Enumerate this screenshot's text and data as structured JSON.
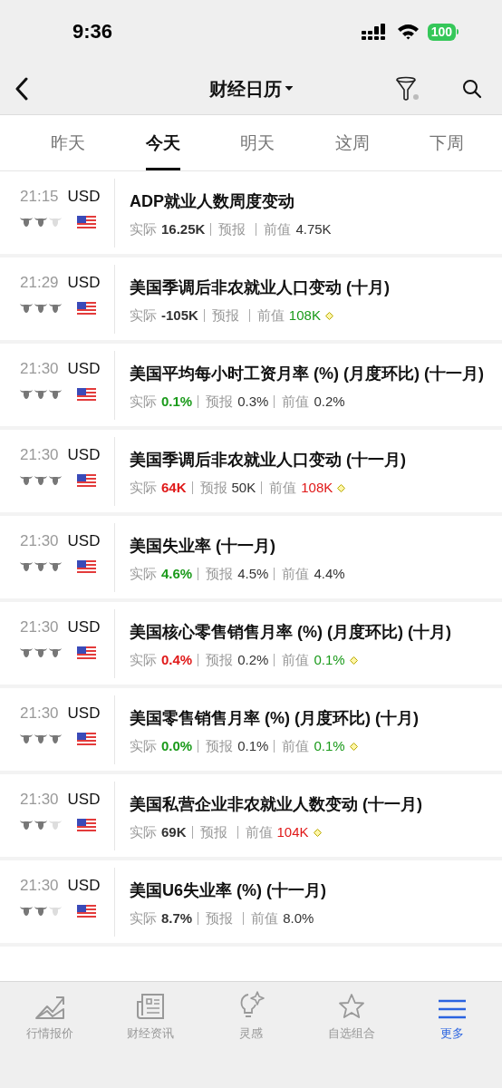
{
  "status_bar": {
    "time": "9:36",
    "battery": "100"
  },
  "nav": {
    "title": "财经日历",
    "filter_active": false
  },
  "tabs": [
    {
      "label": "昨天",
      "selected": false
    },
    {
      "label": "今天",
      "selected": true
    },
    {
      "label": "明天",
      "selected": false
    },
    {
      "label": "这周",
      "selected": false
    },
    {
      "label": "下周",
      "selected": false
    }
  ],
  "events": [
    {
      "time": "21:15",
      "currency": "USD",
      "stars": 2,
      "title": "ADP就业人数周度变动",
      "metrics": [
        {
          "label": "实际",
          "value": "16.25K",
          "color": "#333333"
        },
        {
          "label": "预报"
        },
        {
          "label": "前值",
          "value": "4.75K",
          "color": "#333333",
          "revised": false
        }
      ]
    },
    {
      "time": "21:29",
      "currency": "USD",
      "stars": 3,
      "title": "美国季调后非农就业人口变动 (十月)",
      "metrics": [
        {
          "label": "实际",
          "value": "-105K",
          "color": "#333333"
        },
        {
          "label": "预报"
        },
        {
          "label": "前值",
          "value": "108K",
          "color": "#1a9a1a",
          "revised": true
        }
      ]
    },
    {
      "time": "21:30",
      "currency": "USD",
      "stars": 3,
      "title": "美国平均每小时工资月率 (%) (月度环比) (十一月)",
      "metrics": [
        {
          "label": "实际",
          "value": "0.1%",
          "color": "#1a9a1a"
        },
        {
          "label": "预报",
          "value": "0.3%",
          "color": "#333333"
        },
        {
          "label": "前值",
          "value": "0.2%",
          "color": "#333333",
          "revised": false
        }
      ]
    },
    {
      "time": "21:30",
      "currency": "USD",
      "stars": 3,
      "title": "美国季调后非农就业人口变动 (十一月)",
      "metrics": [
        {
          "label": "实际",
          "value": "64K",
          "color": "#e01818"
        },
        {
          "label": "预报",
          "value": "50K",
          "color": "#333333"
        },
        {
          "label": "前值",
          "value": "108K",
          "color": "#e01818",
          "revised": true
        }
      ]
    },
    {
      "time": "21:30",
      "currency": "USD",
      "stars": 3,
      "title": "美国失业率 (十一月)",
      "metrics": [
        {
          "label": "实际",
          "value": "4.6%",
          "color": "#1a9a1a"
        },
        {
          "label": "预报",
          "value": "4.5%",
          "color": "#333333"
        },
        {
          "label": "前值",
          "value": "4.4%",
          "color": "#333333",
          "revised": false
        }
      ]
    },
    {
      "time": "21:30",
      "currency": "USD",
      "stars": 3,
      "title": "美国核心零售销售月率 (%) (月度环比) (十月)",
      "metrics": [
        {
          "label": "实际",
          "value": "0.4%",
          "color": "#e01818"
        },
        {
          "label": "预报",
          "value": "0.2%",
          "color": "#333333"
        },
        {
          "label": "前值",
          "value": "0.1%",
          "color": "#1a9a1a",
          "revised": true
        }
      ]
    },
    {
      "time": "21:30",
      "currency": "USD",
      "stars": 3,
      "title": "美国零售销售月率 (%) (月度环比) (十月)",
      "metrics": [
        {
          "label": "实际",
          "value": "0.0%",
          "color": "#1a9a1a"
        },
        {
          "label": "预报",
          "value": "0.1%",
          "color": "#333333"
        },
        {
          "label": "前值",
          "value": "0.1%",
          "color": "#1a9a1a",
          "revised": true
        }
      ]
    },
    {
      "time": "21:30",
      "currency": "USD",
      "stars": 2,
      "title": "美国私营企业非农就业人数变动 (十一月)",
      "metrics": [
        {
          "label": "实际",
          "value": "69K",
          "color": "#333333"
        },
        {
          "label": "预报"
        },
        {
          "label": "前值",
          "value": "104K",
          "color": "#e01818",
          "revised": true
        }
      ]
    },
    {
      "time": "21:30",
      "currency": "USD",
      "stars": 2,
      "title": "美国U6失业率 (%) (十一月)",
      "metrics": [
        {
          "label": "实际",
          "value": "8.7%",
          "color": "#333333"
        },
        {
          "label": "预报"
        },
        {
          "label": "前值",
          "value": "8.0%",
          "color": "#333333",
          "revised": false
        }
      ]
    }
  ],
  "bottom_tabs": [
    {
      "label": "行情报价",
      "selected": false
    },
    {
      "label": "财经资讯",
      "selected": false
    },
    {
      "label": "灵感",
      "selected": false
    },
    {
      "label": "自选组合",
      "selected": false
    },
    {
      "label": "更多",
      "selected": true
    }
  ]
}
